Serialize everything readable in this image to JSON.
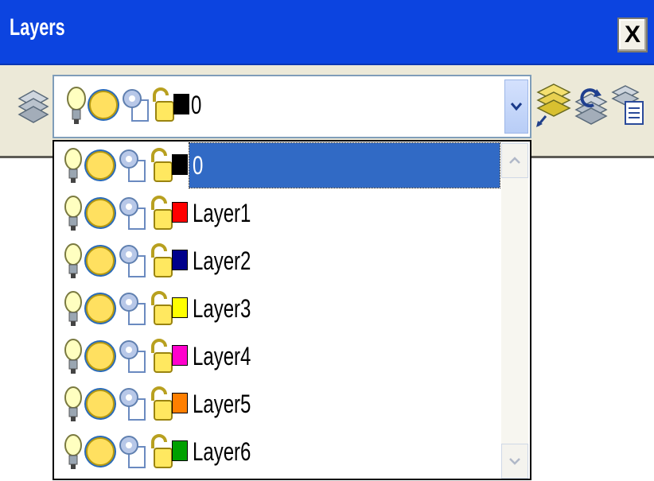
{
  "window": {
    "title": "Layers",
    "close_label": "X"
  },
  "toolbar": {
    "icons": [
      "layer-properties-icon",
      "make-object-layer-current-icon",
      "layer-previous-icon",
      "layer-states-icon"
    ]
  },
  "combo": {
    "current_layer": "0",
    "current_color": "#000000"
  },
  "layers": [
    {
      "name": "0",
      "color": "#000000",
      "selected": true
    },
    {
      "name": "Layer1",
      "color": "#ff0000",
      "selected": false
    },
    {
      "name": "Layer2",
      "color": "#00008b",
      "selected": false
    },
    {
      "name": "Layer3",
      "color": "#ffff00",
      "selected": false
    },
    {
      "name": "Layer4",
      "color": "#ff00cc",
      "selected": false
    },
    {
      "name": "Layer5",
      "color": "#ff7f00",
      "selected": false
    },
    {
      "name": "Layer6",
      "color": "#00a000",
      "selected": false
    }
  ],
  "layer_state_icons": [
    "bulb-on-icon",
    "sun-thawed-icon",
    "viewport-freeze-icon",
    "unlock-icon"
  ]
}
